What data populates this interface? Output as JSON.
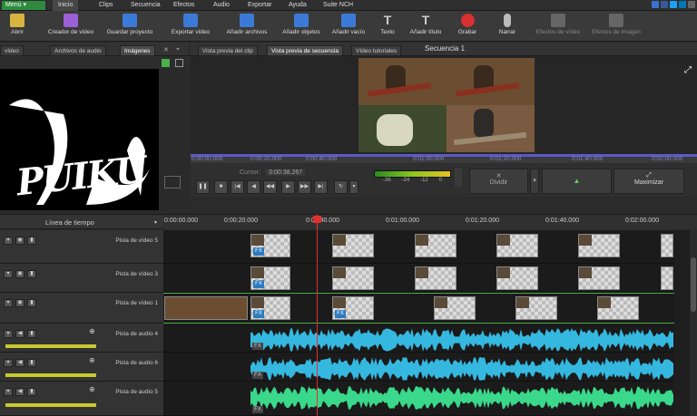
{
  "menubar": {
    "menu_label": "Menú ▾",
    "tabs": [
      "Inicio",
      "Clips",
      "Secuencia",
      "Efectos",
      "Audio",
      "Exportar",
      "Ayuda",
      "Suite NCH"
    ]
  },
  "ribbon": {
    "buttons": [
      {
        "label": "Abrir",
        "icon": "folder-open-icon",
        "color": "#d8b440"
      },
      {
        "label": "Creador de vídeo",
        "icon": "video-creator-icon",
        "color": "#9b5fd6"
      },
      {
        "label": "Guardar proyecto",
        "icon": "save-icon",
        "color": "#3c7ad8"
      },
      {
        "label": "Exportar vídeo",
        "icon": "export-video-icon",
        "color": "#3c7ad8"
      },
      {
        "label": "Añadir archivos",
        "icon": "add-files-icon",
        "color": "#3c7ad8"
      },
      {
        "label": "Añadir objetos",
        "icon": "add-objects-icon",
        "color": "#3c7ad8"
      },
      {
        "label": "Añadir vacío",
        "icon": "add-blank-icon",
        "color": "#3c7ad8"
      },
      {
        "label": "Texto",
        "icon": "text-icon",
        "color": "#cccccc"
      },
      {
        "label": "Añadir título",
        "icon": "add-title-icon",
        "color": "#cccccc"
      },
      {
        "label": "Grabar",
        "icon": "record-icon",
        "color": "#d83030"
      },
      {
        "label": "Narrar",
        "icon": "microphone-icon",
        "color": "#bbbbbb"
      },
      {
        "label": "Efectos de vídeo",
        "icon": "video-effects-icon",
        "color": "#777777"
      },
      {
        "label": "Efectos de imagen",
        "icon": "image-effects-icon",
        "color": "#777777"
      }
    ]
  },
  "left_panel": {
    "tabs": [
      "vídeo",
      "Archivos de audio",
      "Imágenes"
    ],
    "thumb_text": "PUIKU"
  },
  "preview": {
    "tabs": [
      "Vista previa del clip",
      "Vista previa de secuencia",
      "Vídeo tutoriales",
      "Secuencia 1"
    ],
    "ruler_labels": [
      "0:00:00.000",
      "0:00:20.000",
      "0:00:40.000",
      "0:01:00.000",
      "0:01:20.000",
      "0:01:40.000",
      "0:02:00.000"
    ],
    "cursor_label": "Cursor:",
    "cursor_value": "0:00:38.267",
    "vu_labels": [
      "-36",
      "-24",
      "-12",
      "0"
    ],
    "divide_label": "Dividir",
    "maximize_label": "Maximizar"
  },
  "timeline": {
    "header_label": "Línea de tiempo",
    "ruler_labels": [
      "0:00:00.000",
      "0:00:20.000",
      "0:00:40.000",
      "0:01:00.000",
      "0:01:20.000",
      "0:01:40.000",
      "0:02:00.000"
    ],
    "tracks": [
      {
        "name": "Pista de vídeo 5",
        "kind": "video"
      },
      {
        "name": "Pista de vídeo 3",
        "kind": "video"
      },
      {
        "name": "Pista de vídeo 1",
        "kind": "video"
      },
      {
        "name": "Pista de audio 4",
        "kind": "audio",
        "wave_color": "#35b8e0"
      },
      {
        "name": "Pista de audio 6",
        "kind": "audio",
        "wave_color": "#35b8e0"
      },
      {
        "name": "Pista de audio 5",
        "kind": "audio",
        "wave_color": "#3ad88a"
      }
    ],
    "fx_label": "FX"
  }
}
